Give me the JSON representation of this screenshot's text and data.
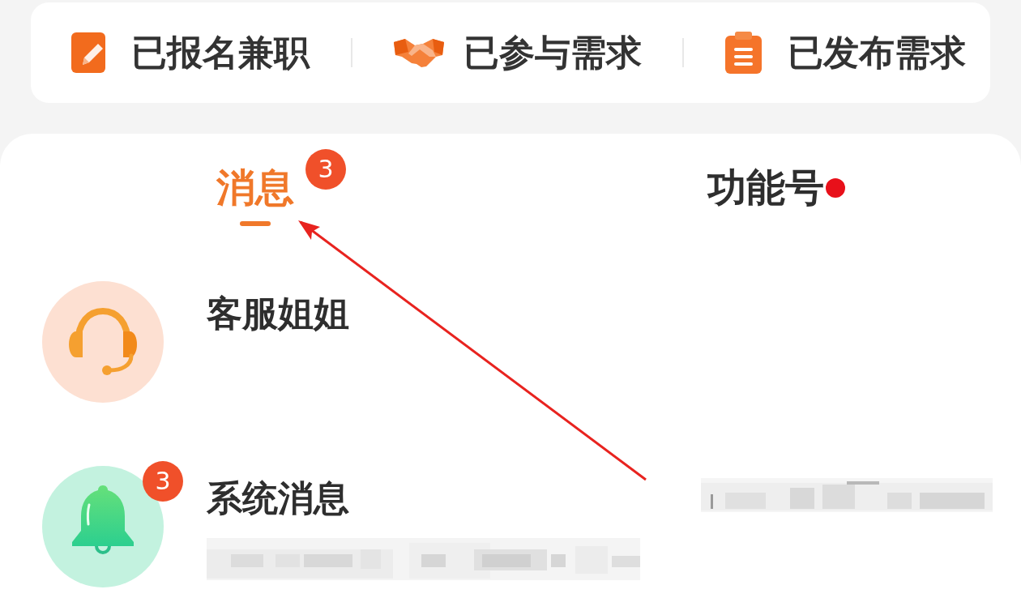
{
  "shortcuts": [
    {
      "label": "已报名兼职",
      "kind": "edit"
    },
    {
      "label": "已参与需求",
      "kind": "handshake"
    },
    {
      "label": "已发布需求",
      "kind": "clipboard"
    }
  ],
  "tabs": [
    {
      "label": "消息",
      "selected": true,
      "badge": "3",
      "dot": false
    },
    {
      "label": "功能号",
      "selected": false,
      "dot": true
    }
  ],
  "conversations": [
    {
      "name": "客服姐姐",
      "kind": "headset",
      "preview_blurred": false,
      "time_blurred": false
    },
    {
      "name": "系统消息",
      "kind": "bell",
      "badge": "3",
      "preview_blurred": true,
      "time_blurred": true
    }
  ],
  "annotations": [
    {
      "kind": "arrow"
    }
  ]
}
